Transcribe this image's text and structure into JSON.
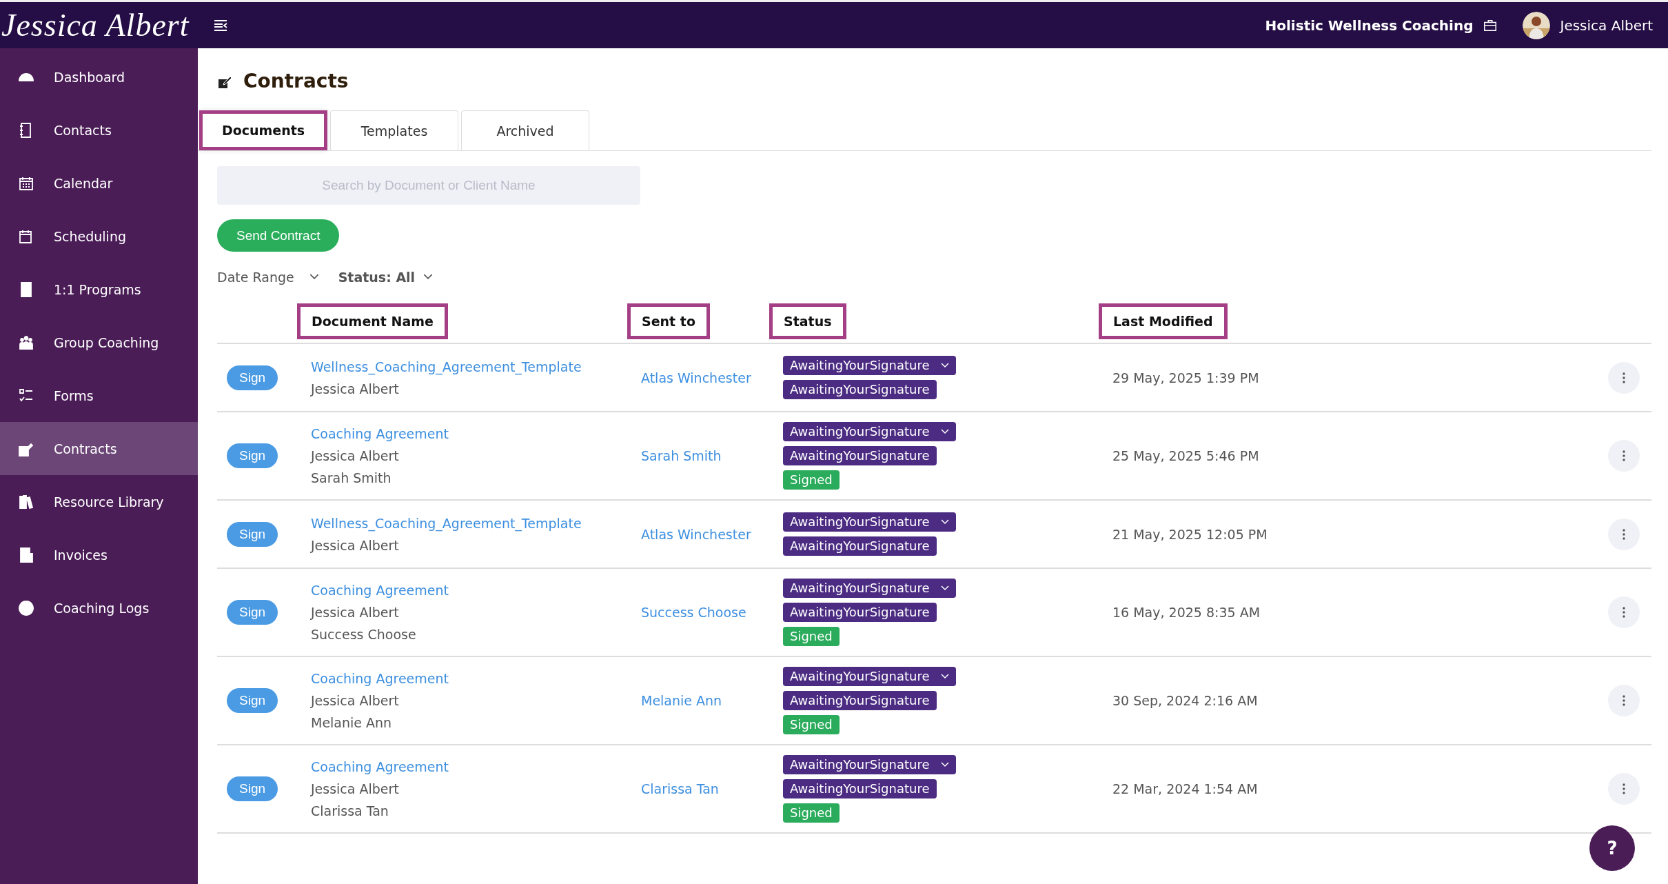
{
  "topbar": {
    "logo": "Jessica Albert",
    "business": "Holistic Wellness Coaching",
    "user": "Jessica Albert"
  },
  "sidebar": {
    "items": [
      {
        "label": "Dashboard",
        "selected": false
      },
      {
        "label": "Contacts",
        "selected": false
      },
      {
        "label": "Calendar",
        "selected": false
      },
      {
        "label": "Scheduling",
        "selected": false
      },
      {
        "label": "1:1 Programs",
        "selected": false
      },
      {
        "label": "Group Coaching",
        "selected": false
      },
      {
        "label": "Forms",
        "selected": false
      },
      {
        "label": "Contracts",
        "selected": true
      },
      {
        "label": "Resource Library",
        "selected": false
      },
      {
        "label": "Invoices",
        "selected": false
      },
      {
        "label": "Coaching Logs",
        "selected": false
      }
    ]
  },
  "page": {
    "title": "Contracts"
  },
  "tabs": [
    {
      "label": "Documents",
      "selected": true,
      "highlighted": true
    },
    {
      "label": "Templates",
      "selected": false,
      "highlighted": false
    },
    {
      "label": "Archived",
      "selected": false,
      "highlighted": false
    }
  ],
  "search": {
    "placeholder": "Search by Document or Client Name"
  },
  "send_button": "Send Contract",
  "filters": [
    "Date Range",
    "Status: All"
  ],
  "table": {
    "columns": [
      {
        "label": "Document Name",
        "highlighted": true
      },
      {
        "label": "Sent to",
        "highlighted": true
      },
      {
        "label": "Status",
        "highlighted": true
      },
      {
        "label": "Last Modified",
        "highlighted": true
      }
    ],
    "rows": [
      {
        "action": "Sign",
        "document": "Wellness_Coaching_Agreement_Template",
        "signers": [
          "Jessica Albert"
        ],
        "sent_to": "Atlas Winchester",
        "statuses": [
          {
            "label": "AwaitingYourSignature",
            "kind": "dropdown",
            "color": "#4b2c82"
          },
          {
            "label": "AwaitingYourSignature",
            "kind": "badge",
            "color": "#4b2c82"
          }
        ],
        "modified": "29 May, 2025 1:39 PM"
      },
      {
        "action": "Sign",
        "document": "Coaching Agreement",
        "signers": [
          "Jessica Albert",
          "Sarah Smith"
        ],
        "sent_to": "Sarah Smith",
        "statuses": [
          {
            "label": "AwaitingYourSignature",
            "kind": "dropdown",
            "color": "#4b2c82"
          },
          {
            "label": "AwaitingYourSignature",
            "kind": "badge",
            "color": "#4b2c82"
          },
          {
            "label": "Signed",
            "kind": "badge",
            "color": "#2bab5c"
          }
        ],
        "modified": "25 May, 2025 5:46 PM"
      },
      {
        "action": "Sign",
        "document": "Wellness_Coaching_Agreement_Template",
        "signers": [
          "Jessica Albert"
        ],
        "sent_to": "Atlas Winchester",
        "statuses": [
          {
            "label": "AwaitingYourSignature",
            "kind": "dropdown",
            "color": "#4b2c82"
          },
          {
            "label": "AwaitingYourSignature",
            "kind": "badge",
            "color": "#4b2c82"
          }
        ],
        "modified": "21 May, 2025 12:05 PM"
      },
      {
        "action": "Sign",
        "document": "Coaching Agreement",
        "signers": [
          "Jessica Albert",
          "Success Choose"
        ],
        "sent_to": "Success Choose",
        "statuses": [
          {
            "label": "AwaitingYourSignature",
            "kind": "dropdown",
            "color": "#4b2c82"
          },
          {
            "label": "AwaitingYourSignature",
            "kind": "badge",
            "color": "#4b2c82"
          },
          {
            "label": "Signed",
            "kind": "badge",
            "color": "#2bab5c"
          }
        ],
        "modified": "16 May, 2025 8:35 AM"
      },
      {
        "action": "Sign",
        "document": "Coaching Agreement",
        "signers": [
          "Jessica Albert",
          "Melanie Ann"
        ],
        "sent_to": "Melanie Ann",
        "statuses": [
          {
            "label": "AwaitingYourSignature",
            "kind": "dropdown",
            "color": "#4b2c82"
          },
          {
            "label": "AwaitingYourSignature",
            "kind": "badge",
            "color": "#4b2c82"
          },
          {
            "label": "Signed",
            "kind": "badge",
            "color": "#2bab5c"
          }
        ],
        "modified": "30 Sep, 2024 2:16 AM"
      },
      {
        "action": "Sign",
        "document": "Coaching Agreement",
        "signers": [
          "Jessica Albert",
          "Clarissa Tan"
        ],
        "sent_to": "Clarissa Tan",
        "statuses": [
          {
            "label": "AwaitingYourSignature",
            "kind": "dropdown",
            "color": "#4b2c82"
          },
          {
            "label": "AwaitingYourSignature",
            "kind": "badge",
            "color": "#4b2c82"
          },
          {
            "label": "Signed",
            "kind": "badge",
            "color": "#2bab5c"
          }
        ],
        "modified": "22 Mar, 2024 1:54 AM"
      }
    ]
  },
  "help_button": "?"
}
